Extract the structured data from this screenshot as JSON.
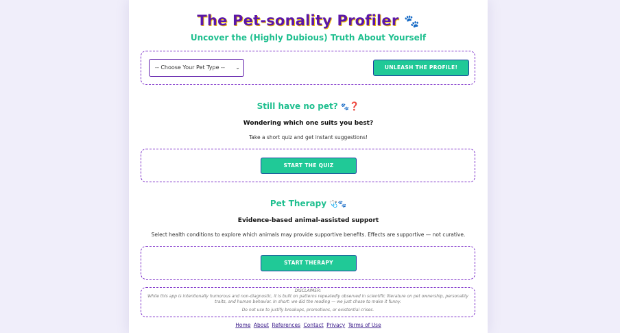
{
  "header": {
    "title": "The Pet-sonality Profiler",
    "title_icon": "paw-icon",
    "subtitle": "Uncover the (Highly Dubious) Truth About Yourself"
  },
  "profile_form": {
    "select_value": "-- Choose Your Pet Type --",
    "submit_label": "UNLEASH THE PROFILE!"
  },
  "no_pet": {
    "heading": "Still have no pet?",
    "heading_icons": [
      "paw-icon",
      "question-icon"
    ],
    "subheading": "Wondering which one suits you best?",
    "text": "Take a short quiz and get instant suggestions!",
    "button_label": "START THE QUIZ"
  },
  "therapy": {
    "heading": "Pet Therapy",
    "heading_icons": [
      "stethoscope-icon",
      "paw-icon"
    ],
    "subheading": "Evidence-based animal-assisted support",
    "text": "Select health conditions to explore which animals may provide supportive benefits. Effects are supportive — not curative.",
    "button_label": "START THERAPY"
  },
  "disclaimer": {
    "heading": "DISCLAIMER:",
    "line1": "While this app is intentionally humorous and non-diagnostic, it is built on patterns repeatedly observed in scientific literature on pet ownership, personality",
    "line2": "traits, and human behavior. In short: we did the reading — we just chose to make it funny.",
    "line3": "Do not use to justify breakups, promotions, or existential crises."
  },
  "footer": {
    "links": [
      "Home",
      "About",
      "References",
      "Contact",
      "Privacy",
      "Terms of Use"
    ]
  },
  "colors": {
    "accent_purple": "#5b17a8",
    "accent_green": "#20c997",
    "title_shadow": "#f2c200"
  }
}
